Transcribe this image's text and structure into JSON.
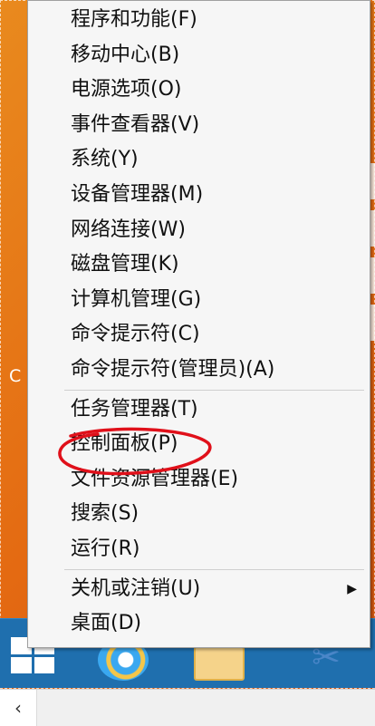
{
  "desktop": {
    "partial_text": "C"
  },
  "context_menu": {
    "groups": [
      {
        "items": [
          {
            "label": "程序和功能(F)"
          },
          {
            "label": "移动中心(B)"
          },
          {
            "label": "电源选项(O)"
          },
          {
            "label": "事件查看器(V)"
          },
          {
            "label": "系统(Y)"
          },
          {
            "label": "设备管理器(M)"
          },
          {
            "label": "网络连接(W)"
          },
          {
            "label": "磁盘管理(K)"
          },
          {
            "label": "计算机管理(G)"
          },
          {
            "label": "命令提示符(C)"
          },
          {
            "label": "命令提示符(管理员)(A)"
          }
        ]
      },
      {
        "items": [
          {
            "label": "任务管理器(T)"
          },
          {
            "label": "控制面板(P)"
          },
          {
            "label": "文件资源管理器(E)"
          },
          {
            "label": "搜索(S)"
          },
          {
            "label": "运行(R)"
          }
        ]
      },
      {
        "items": [
          {
            "label": "关机或注销(U)",
            "has_submenu": true,
            "submenu_icon": "triangle-right-icon"
          },
          {
            "label": "桌面(D)"
          }
        ]
      }
    ]
  },
  "annotation": {
    "color": "#e0101a",
    "highlighted_item": "控制面板(P)"
  },
  "taskbar": {
    "icons": [
      "windows-start-icon",
      "internet-explorer-icon",
      "file-explorer-icon",
      "snipping-tool-icon"
    ]
  },
  "scrollbar": {
    "left_arrow_icon": "chevron-left-icon"
  },
  "colors": {
    "menu_bg": "#f6f6f6",
    "taskbar_bg": "#1f6fae",
    "desktop_bg": "#e46a12"
  }
}
